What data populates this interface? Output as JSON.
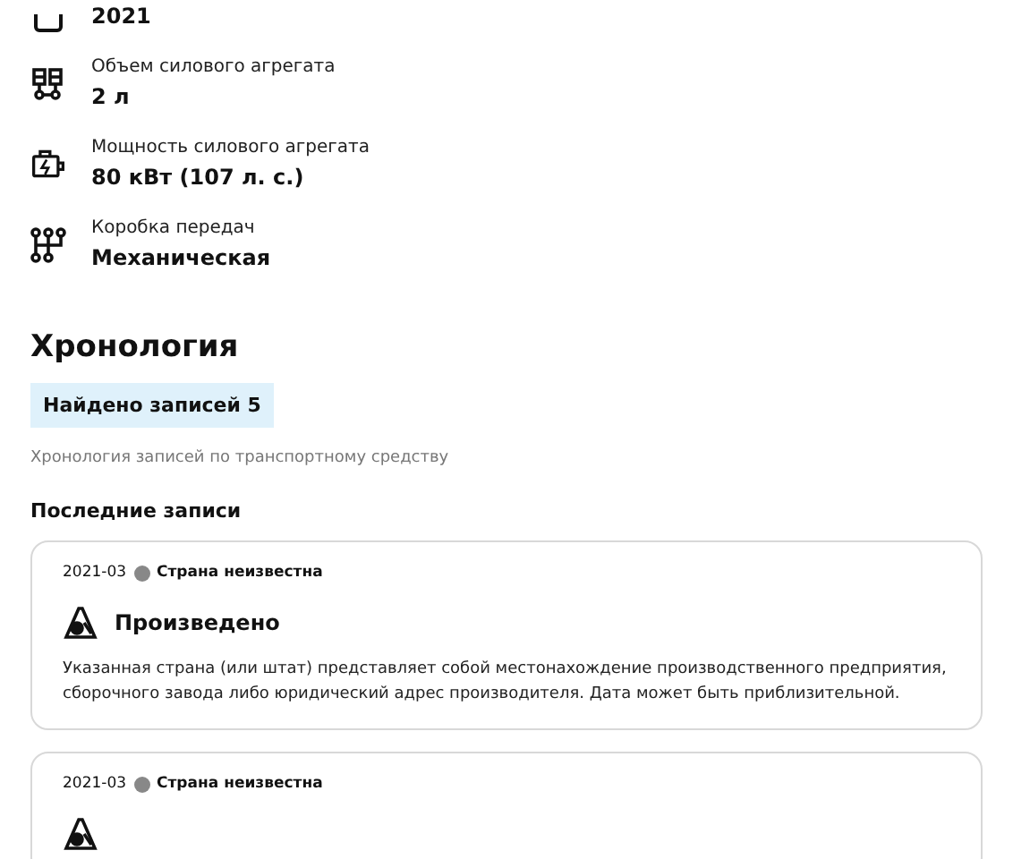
{
  "specs": [
    {
      "kind": "year",
      "value": "2021"
    },
    {
      "kind": "engine",
      "label": "Объем силового агрегата",
      "value": "2 л"
    },
    {
      "kind": "power",
      "label": "Мощность силового агрегата",
      "value": "80 кВт (107 л. с.)"
    },
    {
      "kind": "gearbox",
      "label": "Коробка передач",
      "value": "Механическая"
    }
  ],
  "history": {
    "title": "Хронология",
    "badge": "Найдено записей 5",
    "subtitle": "Хронология записей по транспортному средству",
    "section": "Последние записи",
    "records": [
      {
        "date": "2021-03",
        "country": "Страна неизвестна",
        "kind": "produced",
        "title": "Произведено",
        "text": "Указанная страна (или штат) представляет собой местонахождение производственного предприятия, сборочного завода либо юридический адрес производителя. Дата может быть приблизительной."
      },
      {
        "date": "2021-03",
        "country": "Страна неизвестна",
        "kind": "produced"
      }
    ]
  }
}
